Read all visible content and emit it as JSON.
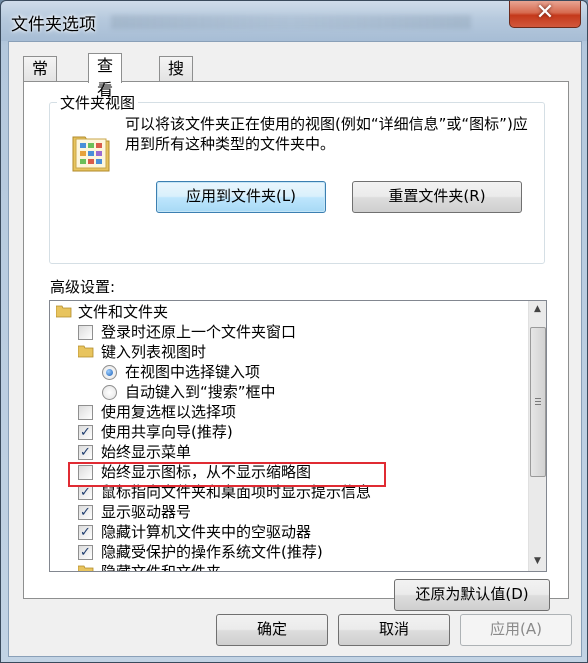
{
  "window": {
    "title": "文件夹选项",
    "close_glyph": "✕"
  },
  "tabs": [
    {
      "label": "常规"
    },
    {
      "label": "查看"
    },
    {
      "label": "搜索"
    }
  ],
  "folder_view": {
    "legend": "文件夹视图",
    "description": "可以将该文件夹正在使用的视图(例如“详细信息”或“图标”)应用到所有这种类型的文件夹中。",
    "apply_button": "应用到文件夹(L)",
    "reset_button": "重置文件夹(R)"
  },
  "advanced": {
    "label": "高级设置:",
    "items": [
      {
        "type": "folder",
        "text": "文件和文件夹"
      },
      {
        "type": "checkbox",
        "checked": false,
        "text": "登录时还原上一个文件夹窗口"
      },
      {
        "type": "folder",
        "text": "键入列表视图时"
      },
      {
        "type": "radio",
        "checked": true,
        "text": "在视图中选择键入项"
      },
      {
        "type": "radio",
        "checked": false,
        "text": "自动键入到“搜索”框中"
      },
      {
        "type": "checkbox",
        "checked": false,
        "text": "使用复选框以选择项"
      },
      {
        "type": "checkbox",
        "checked": true,
        "text": "使用共享向导(推荐)"
      },
      {
        "type": "checkbox",
        "checked": true,
        "text": "始终显示菜单"
      },
      {
        "type": "checkbox",
        "checked": false,
        "text": "始终显示图标，从不显示缩略图"
      },
      {
        "type": "checkbox",
        "checked": true,
        "text": "鼠标指向文件夹和桌面项时显示提示信息"
      },
      {
        "type": "checkbox",
        "checked": true,
        "text": "显示驱动器号"
      },
      {
        "type": "checkbox",
        "checked": true,
        "text": "隐藏计算机文件夹中的空驱动器"
      },
      {
        "type": "checkbox",
        "checked": true,
        "text": "隐藏受保护的操作系统文件(推荐)"
      },
      {
        "type": "folder",
        "text": "隐藏文件和文件夹"
      }
    ],
    "restore_button": "还原为默认值(D)"
  },
  "footer": {
    "ok": "确定",
    "cancel": "取消",
    "apply": "应用(A)"
  },
  "colors": {
    "highlight": "#e02b33",
    "accent": "#3c7fb1"
  }
}
